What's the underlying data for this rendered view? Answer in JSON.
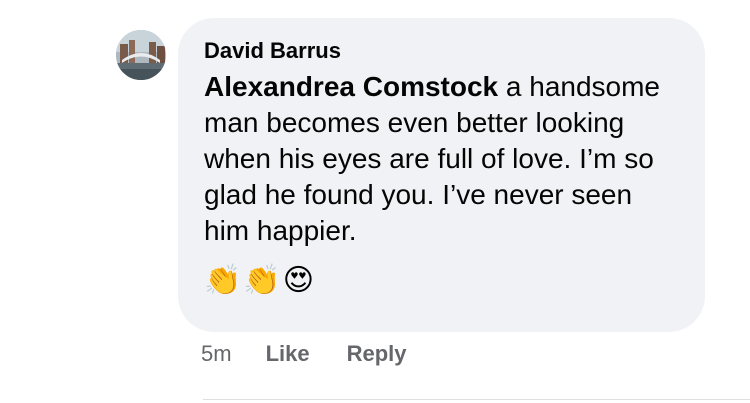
{
  "comment": {
    "author": "David Barrus",
    "mention": "Alexandrea Comstock",
    "text": " a handsome man becomes even better looking when his eyes are full of love.  I’m so glad he found you.  I’ve never seen him happier.",
    "emojis": [
      "👏",
      "👏",
      "😍"
    ],
    "emoji_names": [
      "clapping-hands-emoji",
      "clapping-hands-emoji",
      "heart-eyes-emoji"
    ]
  },
  "actions": {
    "timestamp": "5m",
    "like_label": "Like",
    "reply_label": "Reply"
  },
  "colors": {
    "bubble_background": "#f0f2f5",
    "text": "#050505",
    "secondary_text": "#65676b"
  }
}
